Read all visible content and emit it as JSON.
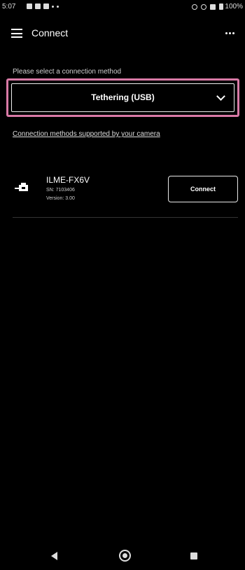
{
  "status_bar": {
    "time": "5:07",
    "battery": "100%"
  },
  "app_bar": {
    "title": "Connect"
  },
  "connection": {
    "prompt": "Please select a connection method",
    "selected_method": "Tethering (USB)",
    "methods_link": "Connection methods supported by your camera"
  },
  "device": {
    "name": "ILME-FX6V",
    "serial": "SN: 7103406",
    "version": "Version: 3.00",
    "connect_label": "Connect"
  },
  "icons": {
    "menu": "menu-icon",
    "more": "more-vert-icon",
    "dropdown": "chevron-down-icon",
    "device": "camera-usb-icon",
    "back": "nav-back-icon",
    "home": "nav-home-icon",
    "recents": "nav-recents-icon"
  },
  "colors": {
    "background": "#000000",
    "highlight": "#d97aa6",
    "text": "#ffffff"
  }
}
